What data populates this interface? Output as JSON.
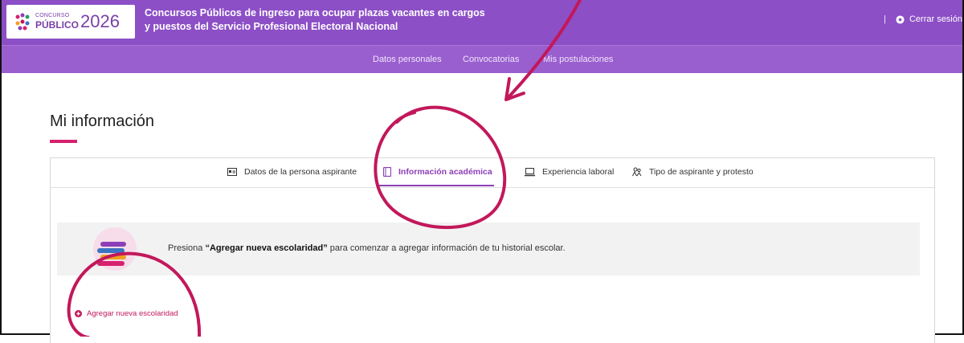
{
  "header": {
    "logo": {
      "small": "CONCURSO",
      "big": "PÚBLICO",
      "year": "2026"
    },
    "title_line1": "Concursos Públicos de ingreso para ocupar plazas vacantes en cargos",
    "title_line2": "y puestos del Servicio Profesional Electoral Nacional",
    "separator": "|",
    "logout_label": "Cerrar sesión",
    "colors": {
      "header": "#8c4fc6",
      "subnav": "#9a5fcf"
    }
  },
  "subnav": {
    "items": [
      "Datos personales",
      "Convocatorias",
      "Mis postulaciones"
    ]
  },
  "page": {
    "title": "Mi información",
    "accent": "#d6216e"
  },
  "tabs": [
    {
      "label": "Datos de la persona aspirante",
      "icon": "id-card-icon"
    },
    {
      "label": "Información académica",
      "icon": "book-icon",
      "active": true
    },
    {
      "label": "Experiencia laboral",
      "icon": "laptop-icon"
    },
    {
      "label": "Tipo de aspirante y protesto",
      "icon": "people-icon"
    }
  ],
  "notice": {
    "prefix": "Presiona ",
    "bold": "“Agregar nueva escolaridad”",
    "suffix": " para comenzar a agregar información de tu historial escolar."
  },
  "add_button": {
    "label": "Agregar nueva escolaridad",
    "color": "#c2185b"
  },
  "annotation_color": "#c2185b"
}
